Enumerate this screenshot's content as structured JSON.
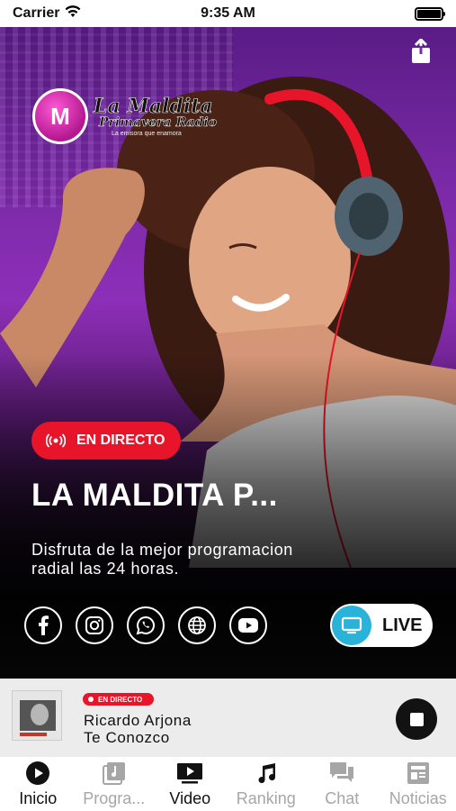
{
  "status_bar": {
    "carrier": "Carrier",
    "time": "9:35 AM"
  },
  "hero": {
    "logo": {
      "title": "La Maldita",
      "subtitle": "Primavera Radio",
      "tagline": "La emisora que enamora"
    },
    "live_badge": "EN DIRECTO",
    "station_title": "LA MALDITA P...",
    "description": "Disfruta de la mejor programacion radial las 24 horas.",
    "socials": [
      {
        "icon": "facebook-icon"
      },
      {
        "icon": "instagram-icon"
      },
      {
        "icon": "whatsapp-icon"
      },
      {
        "icon": "web-globe-icon"
      },
      {
        "icon": "youtube-icon"
      }
    ],
    "live_button": "LIVE"
  },
  "now_playing": {
    "badge": "EN DIRECTO",
    "artist": "Ricardo Arjona",
    "song": "Te Conozco"
  },
  "tabs": [
    {
      "label": "Inicio",
      "icon": "play-circle-icon",
      "active": true
    },
    {
      "label": "Progra...",
      "icon": "music-album-icon",
      "active": false
    },
    {
      "label": "Video",
      "icon": "video-play-icon",
      "active": true
    },
    {
      "label": "Ranking",
      "icon": "music-note-icon",
      "active": false
    },
    {
      "label": "Chat",
      "icon": "chat-bubbles-icon",
      "active": false
    },
    {
      "label": "Noticias",
      "icon": "newspaper-icon",
      "active": false
    }
  ],
  "colors": {
    "accent_red": "#e8152a",
    "live_blue": "#2ab3d8",
    "hero_purple": "#8d2fb8"
  }
}
